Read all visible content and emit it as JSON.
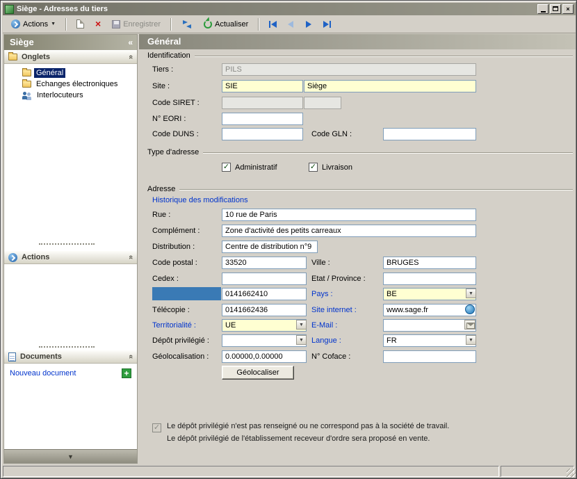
{
  "window": {
    "title": "Siège -  Adresses du tiers"
  },
  "icons": {
    "collapse": "«",
    "chevron_up": "«",
    "close": "×",
    "delete": "×",
    "dropdown": "▼",
    "panel_down": "▼",
    "check": "✓",
    "plus": "+"
  },
  "toolbar": {
    "actions": "Actions",
    "enregistrer": "Enregistrer",
    "actualiser": "Actualiser"
  },
  "sidebar": {
    "title": "Siège",
    "onglets_header": "Onglets",
    "tree": {
      "general": "Général",
      "echanges": "Echanges électroniques",
      "interlocuteurs": "Interlocuteurs"
    },
    "actions_header": "Actions",
    "documents_header": "Documents",
    "nouveau_document": "Nouveau document"
  },
  "main": {
    "header": "Général",
    "groups": {
      "identification": "Identification",
      "type_adresse": "Type d'adresse",
      "adresse": "Adresse"
    },
    "labels": {
      "tiers": "Tiers :",
      "site": "Site :",
      "siret": "Code SIRET :",
      "eori": "N° EORI :",
      "duns": "Code DUNS :",
      "gln": "Code GLN :",
      "administratif": "Administratif",
      "livraison": "Livraison",
      "historique": "Historique des modifications",
      "rue": "Rue :",
      "complement": "Complément :",
      "distribution": "Distribution :",
      "code_postal": "Code postal :",
      "ville": "Ville :",
      "cedex": "Cedex :",
      "etat": "Etat / Province :",
      "pays": "Pays :",
      "telecopie": "Télécopie :",
      "site_internet": "Site internet :",
      "territorialite": "Territorialité :",
      "email": "E-Mail :",
      "depot": "Dépôt privilégié :",
      "langue": "Langue :",
      "geolocalisation": "Géolocalisation :",
      "coface": "N° Coface :"
    },
    "values": {
      "tiers": "PILS",
      "site_code": "SIE",
      "site_name": "Siège",
      "rue": "10 rue de Paris",
      "complement": "Zone d'activité des petits carreaux",
      "distribution": "Centre de distribution n°9",
      "code_postal": "33520",
      "ville": "BRUGES",
      "telephone": "0141662410",
      "pays": "BE",
      "telecopie": "0141662436",
      "site_internet": "www.sage.fr",
      "territorialite": "UE",
      "langue": "FR",
      "geolocalisation": "0.00000,0.00000"
    },
    "buttons": {
      "geolocaliser": "Géolocaliser"
    },
    "footer": {
      "line1": "Le dépôt privilégié n'est pas renseigné ou ne correspond pas à la société de travail.",
      "line2": "Le dépôt privilégié de l'établissement receveur d'ordre sera proposé en vente."
    }
  }
}
